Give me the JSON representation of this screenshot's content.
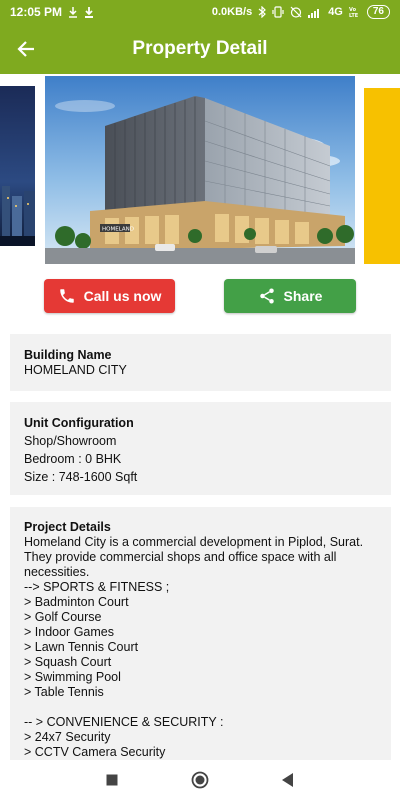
{
  "status_bar": {
    "time": "12:05 PM",
    "speed": "0.0KB/s",
    "network": "4G",
    "battery": "76",
    "icons": [
      "download-icon",
      "download-icon",
      "bluetooth-icon",
      "vibrate-icon",
      "alarm-off-icon",
      "signal-icon",
      "volte-icon",
      "battery-icon"
    ]
  },
  "app_bar": {
    "title": "Property Detail",
    "back_icon": "arrow-left-icon"
  },
  "actions": {
    "call_label": "Call us now",
    "share_label": "Share",
    "call_icon": "phone-icon",
    "share_icon": "share-icon",
    "call_color": "#e53935",
    "share_color": "#43a047"
  },
  "building": {
    "label": "Building Name",
    "value": "HOMELAND CITY"
  },
  "unit": {
    "label": "Unit Configuration",
    "lines": [
      "Shop/Showroom",
      "Bedroom : 0 BHK",
      "Size : 748-1600 Sqft"
    ]
  },
  "project": {
    "label": "Project Details",
    "description": "Homeland City is a commercial development in Piplod, Surat. They provide commercial shops and office space with all necessities.",
    "lines": [
      "--> SPORTS & FITNESS ;",
      "> Badminton Court",
      "> Golf Course",
      "> Indoor Games",
      "> Lawn Tennis Court",
      "> Squash Court",
      "> Swimming Pool",
      "> Table Tennis",
      "",
      "-- > CONVENIENCE & SECURITY :",
      "> 24x7 Security",
      "> CCTV Camera Security"
    ]
  },
  "colors": {
    "primary": "#7faa1f",
    "card_bg": "#f2f2f2",
    "carousel_accent": "#f7c100"
  }
}
